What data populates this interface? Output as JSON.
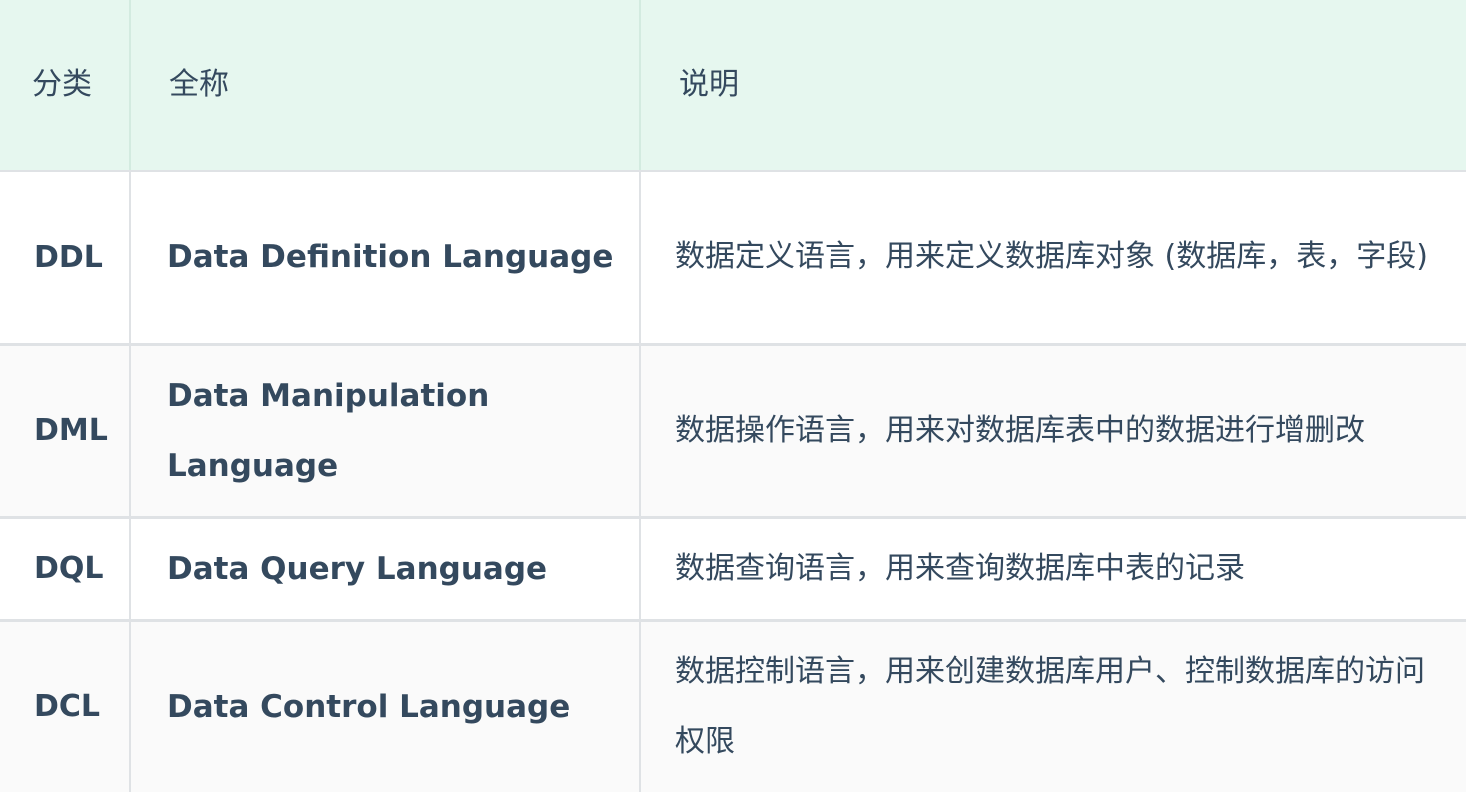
{
  "table": {
    "headers": {
      "category": "分类",
      "full_name": "全称",
      "description": "说明"
    },
    "rows": [
      {
        "abbr": "DDL",
        "full_name": "Data Definition Language",
        "description": "数据定义语言，用来定义数据库对象 (数据库，表，字段)"
      },
      {
        "abbr": "DML",
        "full_name": "Data Manipulation Language",
        "description": "数据操作语言，用来对数据库表中的数据进行增删改"
      },
      {
        "abbr": "DQL",
        "full_name": "Data Query Language",
        "description": "数据查询语言，用来查询数据库中表的记录"
      },
      {
        "abbr": "DCL",
        "full_name": "Data Control Language",
        "description": "数据控制语言，用来创建数据库用户、控制数据库的访问权限"
      }
    ]
  },
  "colors": {
    "header_bg": "#e6f7ef",
    "text": "#34495e",
    "border": "#dfe2e5",
    "stripe_bg": "#fafafa"
  }
}
